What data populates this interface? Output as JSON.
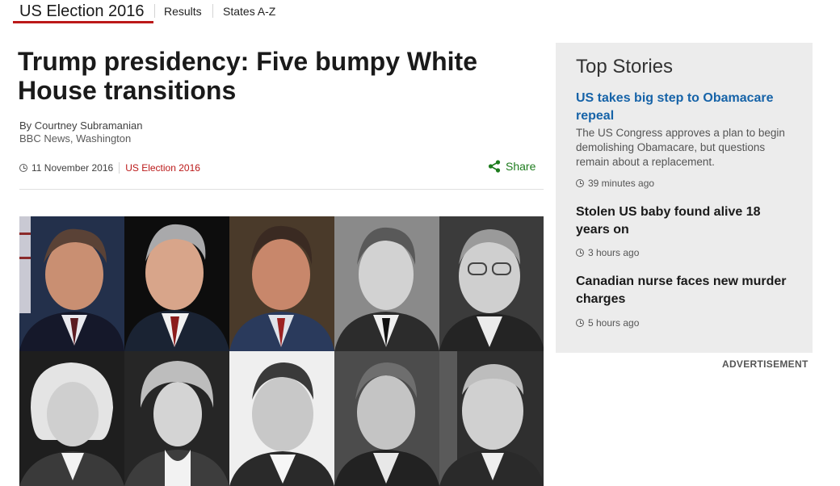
{
  "nav": {
    "title": "US Election 2016",
    "links": [
      "Results",
      "States A-Z"
    ]
  },
  "article": {
    "headline": "Trump presidency: Five bumpy White House transitions",
    "author": "By Courtney Subramanian",
    "author_sub": "BBC News, Washington",
    "date": "11 November 2016",
    "tag": "US Election 2016",
    "share_label": "Share"
  },
  "image": {
    "description_icons": [
      "portrait-bill-clinton",
      "portrait-george-w-bush",
      "portrait-ronald-reagan",
      "portrait-jimmy-carter",
      "portrait-harry-truman",
      "portrait-john-adams",
      "portrait-thomas-jefferson",
      "portrait-herbert-hoover",
      "portrait-franklin-roosevelt",
      "portrait-dwight-eisenhower"
    ]
  },
  "sidebar": {
    "title": "Top Stories",
    "stories": [
      {
        "headline": "US takes big step to Obamacare repeal",
        "summary": "The US Congress approves a plan to begin demolishing Obamacare, but questions remain about a replacement.",
        "time": "39 minutes ago"
      },
      {
        "headline": "Stolen US baby found alive 18 years on",
        "time": "3 hours ago"
      },
      {
        "headline": "Canadian nurse faces new murder charges",
        "time": "5 hours ago"
      }
    ]
  },
  "advert_label": "ADVERTISEMENT",
  "colors": {
    "accent_red": "#bb1919",
    "link_blue": "#1663a8",
    "share_green": "#1e7c1e",
    "sidebar_bg": "#ececec"
  }
}
